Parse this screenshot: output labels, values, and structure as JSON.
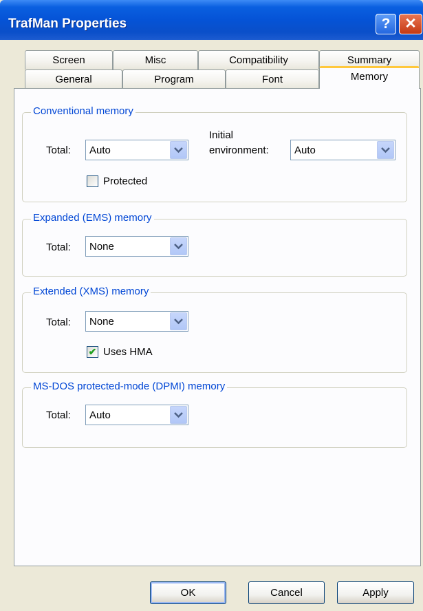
{
  "window": {
    "title": "TrafMan Properties",
    "help_glyph": "?",
    "close_glyph": "✕"
  },
  "tabs": {
    "row1": [
      "Screen",
      "Misc",
      "Compatibility",
      "Summary"
    ],
    "row2": [
      "General",
      "Program",
      "Font",
      "Memory"
    ],
    "active": "Memory"
  },
  "conventional": {
    "legend": "Conventional memory",
    "total_label": "Total:",
    "total_value": "Auto",
    "env_label_1": "Initial",
    "env_label_2": "environment:",
    "env_value": "Auto",
    "protected_label": "Protected",
    "protected_checked": false
  },
  "expanded": {
    "legend": "Expanded (EMS) memory",
    "total_label": "Total:",
    "total_value": "None"
  },
  "extended": {
    "legend": "Extended (XMS) memory",
    "total_label": "Total:",
    "total_value": "None",
    "hma_label": "Uses HMA",
    "hma_checked": true,
    "check_glyph": "✔"
  },
  "dpmi": {
    "legend": "MS-DOS protected-mode (DPMI) memory",
    "total_label": "Total:",
    "total_value": "Auto"
  },
  "buttons": {
    "ok": "OK",
    "cancel": "Cancel",
    "apply": "Apply"
  },
  "colors": {
    "accent": "#0046d5",
    "check": "#21a121",
    "titlebar": "#0553d6",
    "tab_highlight": "#ffc83c"
  },
  "icons": {
    "dropdown": "chevron-down-icon",
    "help": "help-icon",
    "close": "close-icon"
  }
}
